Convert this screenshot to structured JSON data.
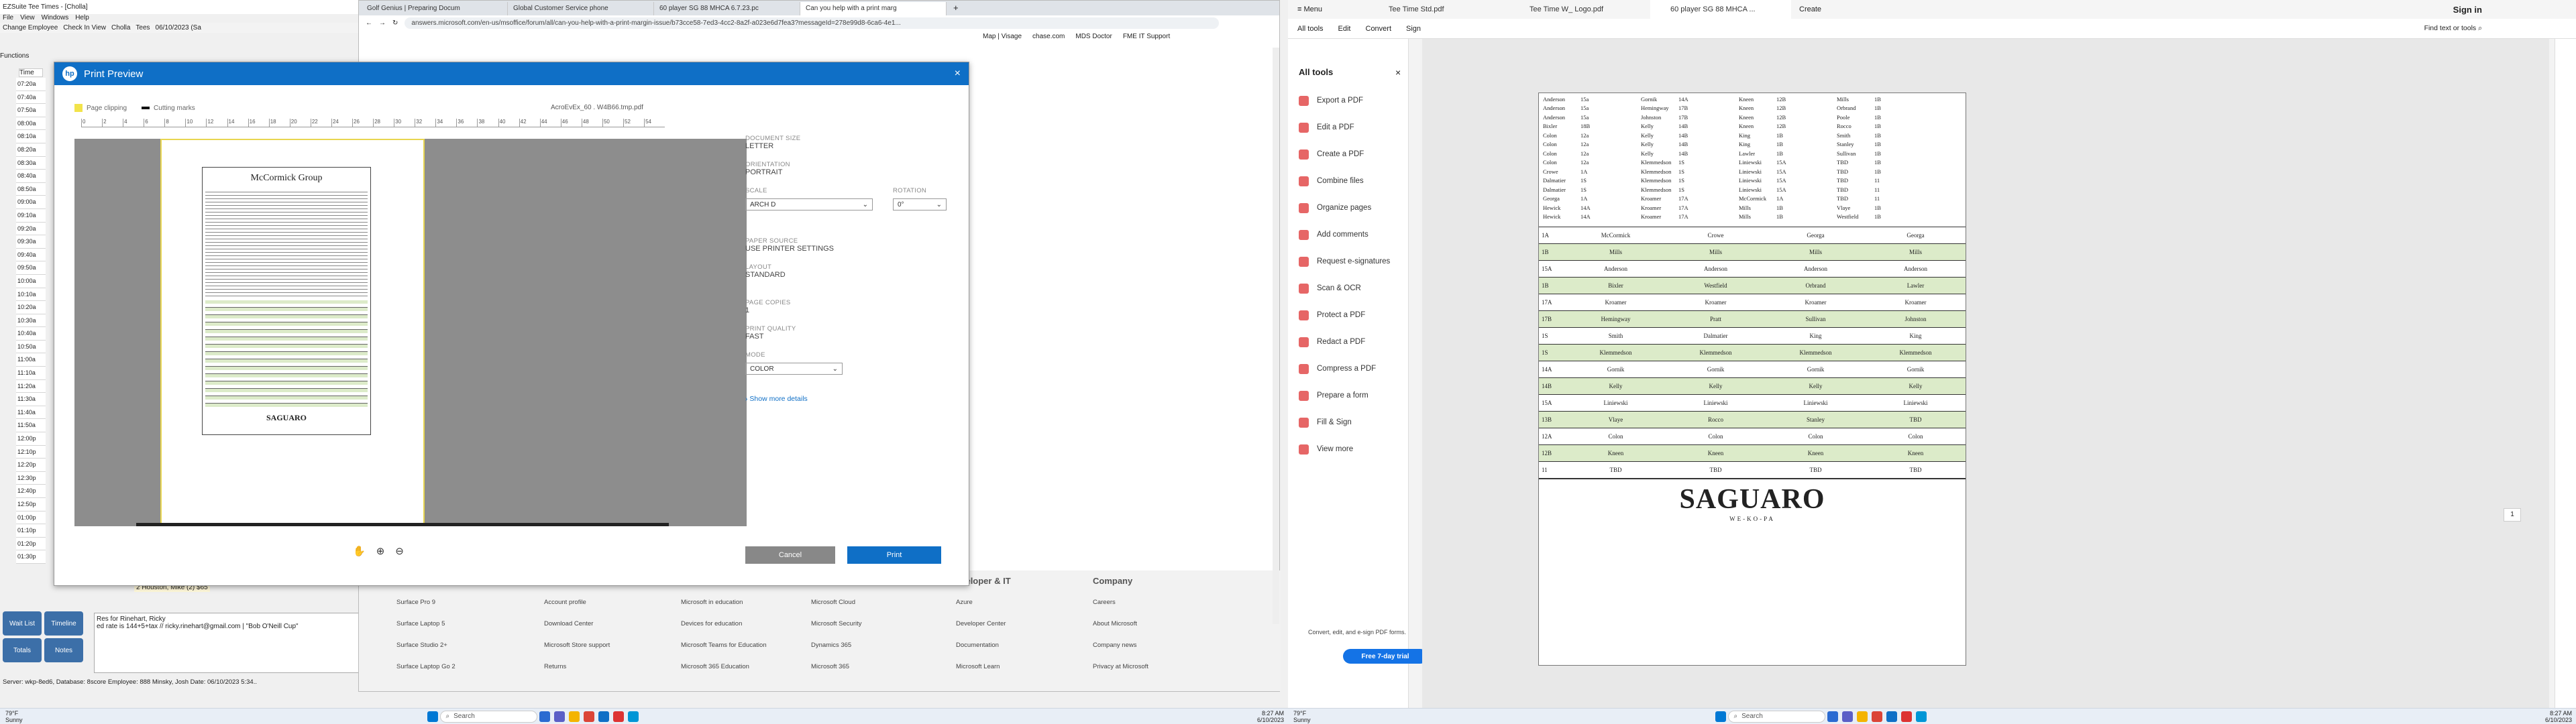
{
  "left_monitor": {
    "ez_title": "EZSuite Tee Times - [Cholla]",
    "ez_menu": [
      "File",
      "View",
      "Windows",
      "Help"
    ],
    "ez_toolbar": [
      "Change Employee",
      "Check In View",
      "Cholla",
      "Tees",
      "06/10/2023 (Sa"
    ],
    "ez_functions": "Functions",
    "time_header": "Time",
    "times": [
      "07:20a",
      "07:40a",
      "07:50a",
      "08:00a",
      "08:10a",
      "08:20a",
      "08:30a",
      "08:40a",
      "08:50a",
      "09:00a",
      "09:10a",
      "09:20a",
      "09:30a",
      "09:40a",
      "09:50a",
      "10:00a",
      "10:10a",
      "10:20a",
      "10:30a",
      "10:40a",
      "10:50a",
      "11:00a",
      "11:10a",
      "11:20a",
      "11:30a",
      "11:40a",
      "11:50a",
      "12:00p",
      "12:10p",
      "12:20p",
      "12:30p",
      "12:40p",
      "12:50p",
      "01:00p",
      "01:10p",
      "01:20p",
      "01:30p"
    ],
    "tee_entry": "2 Houston, Mike (2) $65",
    "side_buttons": [
      "Wait List",
      "Timeline",
      "Totals",
      "Notes"
    ],
    "note_line1": "Res for Rinehart, Ricky",
    "note_line2": "ed rate is 144+5+tax // ricky.rinehart@gmail.com | \"Bob O'Neill Cup\"",
    "status": "Server: wkp-8ed6, Database: 8score      Employee: 888 Minsky, Josh      Date: 06/10/2023 5:34..",
    "browser_tabs": [
      "Golf Genius | Preparing Docum",
      "Global Customer Service phone",
      "60 player SG 88 MHCA 6.7.23.pc",
      "Can you help with a print marg"
    ],
    "address": "answers.microsoft.com/en-us/msoffice/forum/all/can-you-help-with-a-print-margin-issue/b73cce58-7ed3-4cc2-8a2f-a023e6d7fea3?messageId=278e99d8-6ca6-4e1...",
    "bookmarks": [
      "Map | Visage",
      "chase.com",
      "MDS Doctor",
      "FME IT Support"
    ],
    "print_title": "Print Preview",
    "legend_clipping": "Page clipping",
    "legend_cutting": "Cutting marks",
    "file_name": "AcroEvEx_60 . W4B66.tmp.pdf",
    "ruler_numbers": [
      "0",
      "2",
      "4",
      "6",
      "8",
      "10",
      "12",
      "14",
      "16",
      "18",
      "20",
      "22",
      "24",
      "26",
      "28",
      "30",
      "32",
      "34",
      "36",
      "38",
      "40",
      "42",
      "44",
      "46",
      "48",
      "50",
      "52",
      "54"
    ],
    "doc_size_label": "DOCUMENT SIZE",
    "doc_size": "LETTER",
    "orientation_label": "ORIENTATION",
    "orientation": "PORTRAIT",
    "scale_label": "SCALE",
    "scale": "ARCH D",
    "rotation_label": "ROTATION",
    "rotation": "0°",
    "paper_source_label": "PAPER SOURCE",
    "paper_source": "USE PRINTER SETTINGS",
    "layout_label": "LAYOUT",
    "layout": "STANDARD",
    "copies_label": "PAGE COPIES",
    "copies": "1",
    "quality_label": "PRINT QUALITY",
    "quality": "FAST",
    "mode_label": "MODE",
    "mode": "COLOR",
    "show_more": "Show more details",
    "cancel": "Cancel",
    "print": "Print",
    "preview_title": "McCormick Group",
    "preview_logo": "SAGUARO",
    "footer_cols": [
      {
        "head": "",
        "items": [
          "Surface Pro 9",
          "Surface Laptop 5",
          "Surface Studio 2+",
          "Surface Laptop Go 2"
        ]
      },
      {
        "head": "",
        "items": [
          "Account profile",
          "Download Center",
          "Microsoft Store support",
          "Returns"
        ]
      },
      {
        "head": "",
        "items": [
          "Microsoft in education",
          "Devices for education",
          "Microsoft Teams for Education",
          "Microsoft 365 Education"
        ]
      },
      {
        "head": "",
        "items": [
          "Microsoft Cloud",
          "Microsoft Security",
          "Dynamics 365",
          "Microsoft 365"
        ]
      },
      {
        "head": "eveloper & IT",
        "items": [
          "Azure",
          "Developer Center",
          "Documentation",
          "Microsoft Learn"
        ]
      },
      {
        "head": "Company",
        "items": [
          "Careers",
          "About Microsoft",
          "Company news",
          "Privacy at Microsoft"
        ]
      }
    ],
    "weather_temp": "79°F",
    "weather_text": "Sunny",
    "search_placeholder": "Search",
    "clock_time": "8:27 AM",
    "clock_date": "6/10/2023"
  },
  "right_monitor": {
    "tabs": [
      "Tee Time Std.pdf",
      "Tee Time W_ Logo.pdf",
      "60 player SG 88 MHCA ...",
      "Create"
    ],
    "menu_label": "Menu",
    "sign_in": "Sign in",
    "menu": [
      "All tools",
      "Edit",
      "Convert",
      "Sign"
    ],
    "find_text": "Find text or tools",
    "all_tools_title": "All tools",
    "tools": [
      "Export a PDF",
      "Edit a PDF",
      "Create a PDF",
      "Combine files",
      "Organize pages",
      "Add comments",
      "Request e-signatures",
      "Scan & OCR",
      "Protect a PDF",
      "Redact a PDF",
      "Compress a PDF",
      "Prepare a form",
      "Fill & Sign",
      "View more"
    ],
    "promo": "Convert, edit, and e-sign PDF forms.",
    "trial_button": "Free 7-day trial",
    "upper_rows": [
      [
        "Anderson",
        "15a",
        "Gornik",
        "14A",
        "Kneen",
        "12B",
        "Mills",
        "1B"
      ],
      [
        "Anderson",
        "15a",
        "Hemingway",
        "17B",
        "Kneen",
        "12B",
        "Orbrand",
        "1B"
      ],
      [
        "Anderson",
        "15a",
        "Johnston",
        "17B",
        "Kneen",
        "12B",
        "Poole",
        "1B"
      ],
      [
        "Bixler",
        "18B",
        "Kelly",
        "14B",
        "Kneen",
        "12B",
        "Rocco",
        "1B"
      ],
      [
        "Colon",
        "12a",
        "Kelly",
        "14B",
        "King",
        "1B",
        "Smith",
        "1B"
      ],
      [
        "Colon",
        "12a",
        "Kelly",
        "14B",
        "King",
        "1B",
        "Stanley",
        "1B"
      ],
      [
        "Colon",
        "12a",
        "Kelly",
        "14B",
        "Lawler",
        "1B",
        "Sullivan",
        "1B"
      ],
      [
        "Colon",
        "12a",
        "Klemmedson",
        "1S",
        "Liniewski",
        "15A",
        "TBD",
        "1B"
      ],
      [
        "Crowe",
        "1A",
        "Klemmedson",
        "1S",
        "Liniewski",
        "15A",
        "TBD",
        "1B"
      ],
      [
        "Dalmatier",
        "1S",
        "Klemmedson",
        "1S",
        "Liniewski",
        "15A",
        "TBD",
        "11"
      ],
      [
        "Dalmatier",
        "1S",
        "Klemmedson",
        "1S",
        "Liniewski",
        "15A",
        "TBD",
        "11"
      ],
      [
        "Georga",
        "1A",
        "Kroamer",
        "17A",
        "McCormick",
        "1A",
        "TBD",
        "11"
      ],
      [
        "Hewick",
        "14A",
        "Kroamer",
        "17A",
        "Mills",
        "1B",
        "Vlaye",
        "1B"
      ],
      [
        "Hewick",
        "14A",
        "Kroamer",
        "17A",
        "Mills",
        "1B",
        "Westfield",
        "1B"
      ]
    ],
    "lower_rows": [
      [
        "1A",
        "McCormick",
        "Crowe",
        "Georga",
        "Georga"
      ],
      [
        "1B",
        "Mills",
        "Mills",
        "Mills",
        "Mills"
      ],
      [
        "15A",
        "Anderson",
        "Anderson",
        "Anderson",
        "Anderson"
      ],
      [
        "1B",
        "Bixler",
        "Westfield",
        "Orbrand",
        "Lawler"
      ],
      [
        "17A",
        "Kroamer",
        "Kroamer",
        "Kroamer",
        "Kroamer"
      ],
      [
        "17B",
        "Hemingway",
        "Pratt",
        "Sullivan",
        "Johnston"
      ],
      [
        "1S",
        "Smith",
        "Dalmatier",
        "King",
        "King"
      ],
      [
        "1S",
        "Klemmedson",
        "Klemmedson",
        "Klemmedson",
        "Klemmedson"
      ],
      [
        "14A",
        "Gornik",
        "Gornik",
        "Gornik",
        "Gornik"
      ],
      [
        "14B",
        "Kelly",
        "Kelly",
        "Kelly",
        "Kelly"
      ],
      [
        "15A",
        "Liniewski",
        "Liniewski",
        "Liniewski",
        "Liniewski"
      ],
      [
        "13B",
        "Vlaye",
        "Rocco",
        "Stanley",
        "TBD"
      ],
      [
        "12A",
        "Colon",
        "Colon",
        "Colon",
        "Colon"
      ],
      [
        "12B",
        "Kneen",
        "Kneen",
        "Kneen",
        "Kneen"
      ],
      [
        "11",
        "TBD",
        "TBD",
        "TBD",
        "TBD"
      ]
    ],
    "logo": "SAGUARO",
    "logo_sub": "WE-KO-PA",
    "page_number": "1",
    "weather_temp": "79°F",
    "weather_text": "Sunny",
    "search_placeholder": "Search",
    "clock_time": "8:27 AM",
    "clock_date": "6/10/2023"
  },
  "colors": {
    "hp_blue": "#0f6fc6",
    "acrobat_blue": "#1473e6",
    "tee_green": "#dcebc9"
  }
}
